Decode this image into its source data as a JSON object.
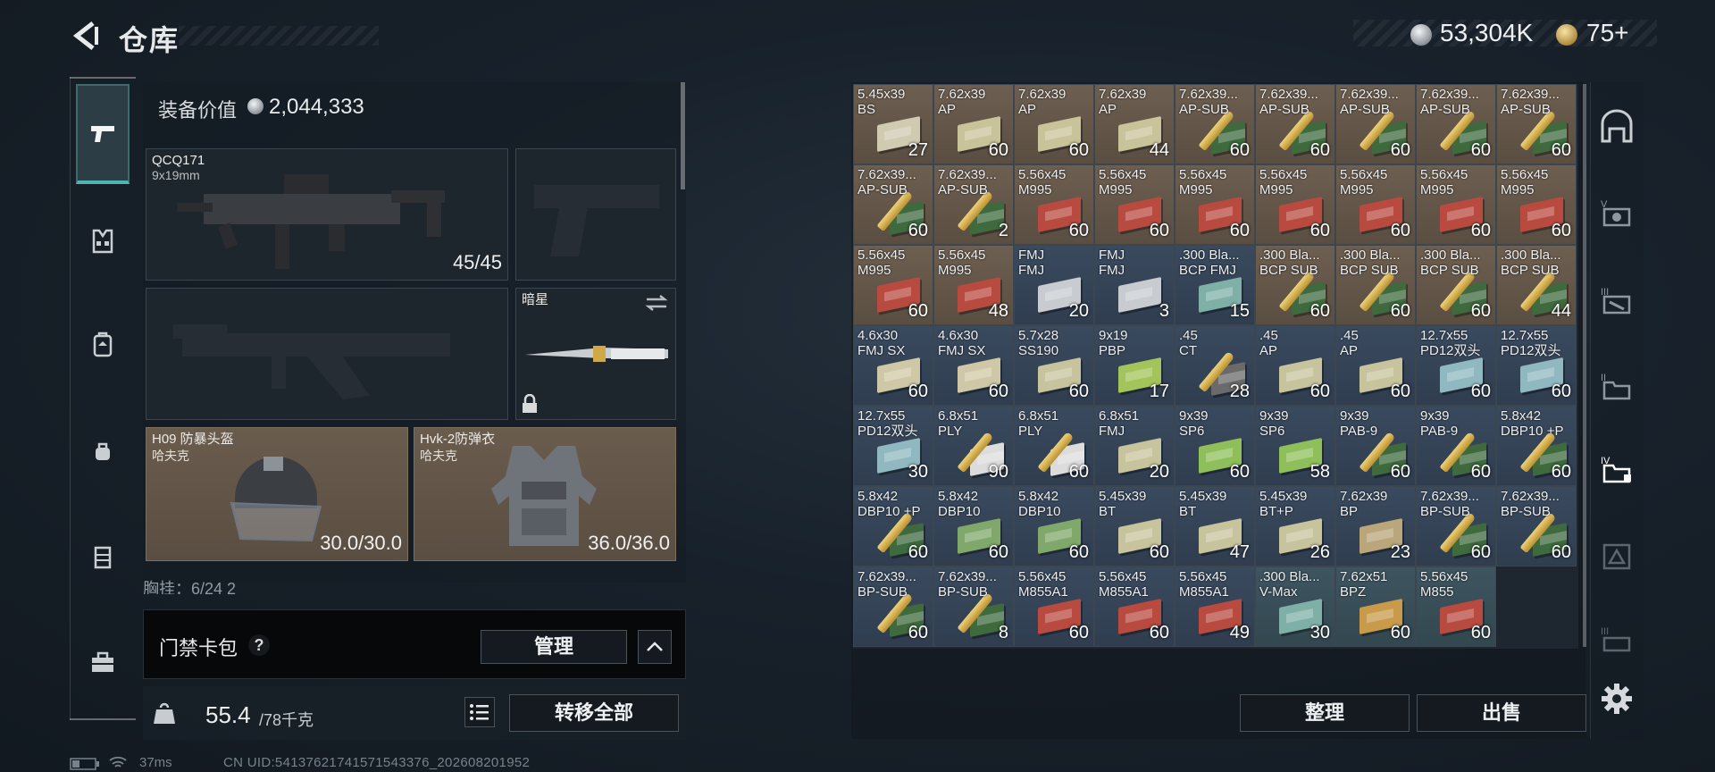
{
  "header": {
    "title": "仓库",
    "silver_amount": "53,304K",
    "gold_amount": "75+"
  },
  "equipment": {
    "value_label": "装备价值",
    "value": "2,044,333",
    "primary": {
      "name": "QCQ171",
      "caliber": "9x19mm",
      "ammo": "45/45"
    },
    "melee": {
      "name": "暗星"
    },
    "helmet": {
      "name": "H09 防暴头盔",
      "brand": "哈夫克",
      "durability": "30.0/30.0"
    },
    "armor": {
      "name": "Hvk-2防弹衣",
      "brand": "哈夫克",
      "durability": "36.0/36.0"
    },
    "chest_rig": "胸挂：6/24  2"
  },
  "keycard": {
    "label": "门禁卡包",
    "help": "?",
    "manage": "管理"
  },
  "weight": {
    "current": "55.4",
    "max": "/78千克",
    "transfer_all": "转移全部"
  },
  "status": {
    "ping": "37ms",
    "uid": "CN UID:54137621741571543376_202608201952"
  },
  "stash": {
    "tidy": "整理",
    "sell": "出售",
    "items": [
      {
        "name": "5.45x39\nBS",
        "count": "27",
        "bg": "brown",
        "kind": "box",
        "c": "#cfcab0"
      },
      {
        "name": "7.62x39\nAP",
        "count": "60",
        "bg": "brown",
        "kind": "box",
        "c": "#c9c39a"
      },
      {
        "name": "7.62x39\nAP",
        "count": "60",
        "bg": "brown",
        "kind": "box",
        "c": "#c9c39a"
      },
      {
        "name": "7.62x39\nAP",
        "count": "44",
        "bg": "brown",
        "kind": "box",
        "c": "#c9c39a"
      },
      {
        "name": "7.62x39...\nAP-SUB",
        "count": "60",
        "bg": "brown",
        "kind": "bullet",
        "c": "#3e6a3e"
      },
      {
        "name": "7.62x39...\nAP-SUB",
        "count": "60",
        "bg": "brown",
        "kind": "bullet",
        "c": "#3e6a3e"
      },
      {
        "name": "7.62x39...\nAP-SUB",
        "count": "60",
        "bg": "brown",
        "kind": "bullet",
        "c": "#3e6a3e"
      },
      {
        "name": "7.62x39...\nAP-SUB",
        "count": "60",
        "bg": "brown",
        "kind": "bullet",
        "c": "#3e6a3e"
      },
      {
        "name": "7.62x39...\nAP-SUB",
        "count": "60",
        "bg": "brown",
        "kind": "bullet",
        "c": "#3e6a3e"
      },
      {
        "name": "7.62x39...\nAP-SUB",
        "count": "60",
        "bg": "brown",
        "kind": "bullet",
        "c": "#3e6a3e"
      },
      {
        "name": "7.62x39...\nAP-SUB",
        "count": "2",
        "bg": "brown",
        "kind": "bullet",
        "c": "#3e6a3e"
      },
      {
        "name": "5.56x45\nM995",
        "count": "60",
        "bg": "brown",
        "kind": "box",
        "c": "#b94a40"
      },
      {
        "name": "5.56x45\nM995",
        "count": "60",
        "bg": "brown",
        "kind": "box",
        "c": "#b94a40"
      },
      {
        "name": "5.56x45\nM995",
        "count": "60",
        "bg": "brown",
        "kind": "box",
        "c": "#b94a40"
      },
      {
        "name": "5.56x45\nM995",
        "count": "60",
        "bg": "brown",
        "kind": "box",
        "c": "#b94a40"
      },
      {
        "name": "5.56x45\nM995",
        "count": "60",
        "bg": "brown",
        "kind": "box",
        "c": "#b94a40"
      },
      {
        "name": "5.56x45\nM995",
        "count": "60",
        "bg": "brown",
        "kind": "box",
        "c": "#b94a40"
      },
      {
        "name": "5.56x45\nM995",
        "count": "60",
        "bg": "brown",
        "kind": "box",
        "c": "#b94a40"
      },
      {
        "name": "5.56x45\nM995",
        "count": "60",
        "bg": "brown",
        "kind": "box",
        "c": "#b94a40"
      },
      {
        "name": "5.56x45\nM995",
        "count": "48",
        "bg": "brown",
        "kind": "box",
        "c": "#b94a40"
      },
      {
        "name": "FMJ\nFMJ",
        "count": "20",
        "bg": "blue",
        "kind": "box",
        "c": "#c8ccd0"
      },
      {
        "name": "FMJ\nFMJ",
        "count": "3",
        "bg": "blue",
        "kind": "box",
        "c": "#c8ccd0"
      },
      {
        "name": ".300 Bla...\nBCP FMJ",
        "count": "15",
        "bg": "blue",
        "kind": "box",
        "c": "#7fb0a8"
      },
      {
        "name": ".300 Bla...\nBCP SUB",
        "count": "60",
        "bg": "brown",
        "kind": "bullet",
        "c": "#3e6a3e"
      },
      {
        "name": ".300 Bla...\nBCP SUB",
        "count": "60",
        "bg": "brown",
        "kind": "bullet",
        "c": "#3e6a3e"
      },
      {
        "name": ".300 Bla...\nBCP SUB",
        "count": "60",
        "bg": "brown",
        "kind": "bullet",
        "c": "#3e6a3e"
      },
      {
        "name": ".300 Bla...\nBCP SUB",
        "count": "44",
        "bg": "brown",
        "kind": "bullet",
        "c": "#3e6a3e"
      },
      {
        "name": "4.6x30\nFMJ SX",
        "count": "60",
        "bg": "blue",
        "kind": "box",
        "c": "#cfc8a6"
      },
      {
        "name": "4.6x30\nFMJ SX",
        "count": "60",
        "bg": "blue",
        "kind": "box",
        "c": "#cfc8a6"
      },
      {
        "name": "5.7x28\nSS190",
        "count": "60",
        "bg": "blue",
        "kind": "box",
        "c": "#c7c39d"
      },
      {
        "name": "9x19\nPBP",
        "count": "17",
        "bg": "blue",
        "kind": "box",
        "c": "#a3c45a"
      },
      {
        "name": ".45\nCT",
        "count": "28",
        "bg": "blue",
        "kind": "bullet",
        "c": "#6a6a6a"
      },
      {
        "name": ".45\nAP",
        "count": "60",
        "bg": "blue",
        "kind": "box",
        "c": "#c7c39d"
      },
      {
        "name": ".45\nAP",
        "count": "60",
        "bg": "blue",
        "kind": "box",
        "c": "#c7c39d"
      },
      {
        "name": "12.7x55\nPD12双头",
        "count": "60",
        "bg": "blue",
        "kind": "box",
        "c": "#8fb8c0"
      },
      {
        "name": "12.7x55\nPD12双头",
        "count": "60",
        "bg": "blue",
        "kind": "box",
        "c": "#8fb8c0"
      },
      {
        "name": "12.7x55\nPD12双头",
        "count": "30",
        "bg": "blue",
        "kind": "box",
        "c": "#8fb8c0"
      },
      {
        "name": "6.8x51\nPLY",
        "count": "90",
        "bg": "blue",
        "kind": "bullet",
        "c": "#dcdcdc"
      },
      {
        "name": "6.8x51\nPLY",
        "count": "60",
        "bg": "blue",
        "kind": "bullet",
        "c": "#dcdcdc"
      },
      {
        "name": "6.8x51\nFMJ",
        "count": "20",
        "bg": "blue",
        "kind": "box",
        "c": "#c7c39d"
      },
      {
        "name": "9x39\nSP6",
        "count": "60",
        "bg": "blue",
        "kind": "box",
        "c": "#8fbf5a"
      },
      {
        "name": "9x39\nSP6",
        "count": "58",
        "bg": "blue",
        "kind": "box",
        "c": "#8fbf5a"
      },
      {
        "name": "9x39\nPAB-9",
        "count": "60",
        "bg": "blue",
        "kind": "bullet",
        "c": "#3e6a3e"
      },
      {
        "name": "9x39\nPAB-9",
        "count": "60",
        "bg": "blue",
        "kind": "bullet",
        "c": "#3e6a3e"
      },
      {
        "name": "5.8x42\nDBP10 +P",
        "count": "60",
        "bg": "blue",
        "kind": "bullet",
        "c": "#3e6a3e"
      },
      {
        "name": "5.8x42\nDBP10 +P",
        "count": "60",
        "bg": "blue",
        "kind": "bullet",
        "c": "#3e6a3e"
      },
      {
        "name": "5.8x42\nDBP10",
        "count": "60",
        "bg": "blue",
        "kind": "box",
        "c": "#7fa86a"
      },
      {
        "name": "5.8x42\nDBP10",
        "count": "60",
        "bg": "blue",
        "kind": "box",
        "c": "#7fa86a"
      },
      {
        "name": "5.45x39\nBT",
        "count": "60",
        "bg": "blue",
        "kind": "box",
        "c": "#c7c39d"
      },
      {
        "name": "5.45x39\nBT",
        "count": "47",
        "bg": "blue",
        "kind": "box",
        "c": "#c7c39d"
      },
      {
        "name": "5.45x39\nBT+P",
        "count": "26",
        "bg": "blue",
        "kind": "box",
        "c": "#c7c39d"
      },
      {
        "name": "7.62x39\nBP",
        "count": "23",
        "bg": "blue",
        "kind": "box",
        "c": "#b9a67a"
      },
      {
        "name": "7.62x39...\nBP-SUB",
        "count": "60",
        "bg": "blue",
        "kind": "bullet",
        "c": "#3e6a3e"
      },
      {
        "name": "7.62x39...\nBP-SUB",
        "count": "60",
        "bg": "blue",
        "kind": "bullet",
        "c": "#3e6a3e"
      },
      {
        "name": "7.62x39...\nBP-SUB",
        "count": "60",
        "bg": "blue",
        "kind": "bullet",
        "c": "#3e6a3e"
      },
      {
        "name": "7.62x39...\nBP-SUB",
        "count": "8",
        "bg": "blue",
        "kind": "bullet",
        "c": "#3e6a3e"
      },
      {
        "name": "5.56x45\nM855A1",
        "count": "60",
        "bg": "blue",
        "kind": "box",
        "c": "#b94a40"
      },
      {
        "name": "5.56x45\nM855A1",
        "count": "60",
        "bg": "blue",
        "kind": "box",
        "c": "#b94a40"
      },
      {
        "name": "5.56x45\nM855A1",
        "count": "49",
        "bg": "blue",
        "kind": "box",
        "c": "#b94a40"
      },
      {
        "name": ".300 Bla...\nV-Max",
        "count": "30",
        "bg": "teal",
        "kind": "box",
        "c": "#7fb0a8"
      },
      {
        "name": "7.62x51\nBPZ",
        "count": "60",
        "bg": "teal",
        "kind": "box",
        "c": "#c89a4a"
      },
      {
        "name": "5.56x45\nM855",
        "count": "60",
        "bg": "teal",
        "kind": "box",
        "c": "#b94a40"
      }
    ]
  }
}
